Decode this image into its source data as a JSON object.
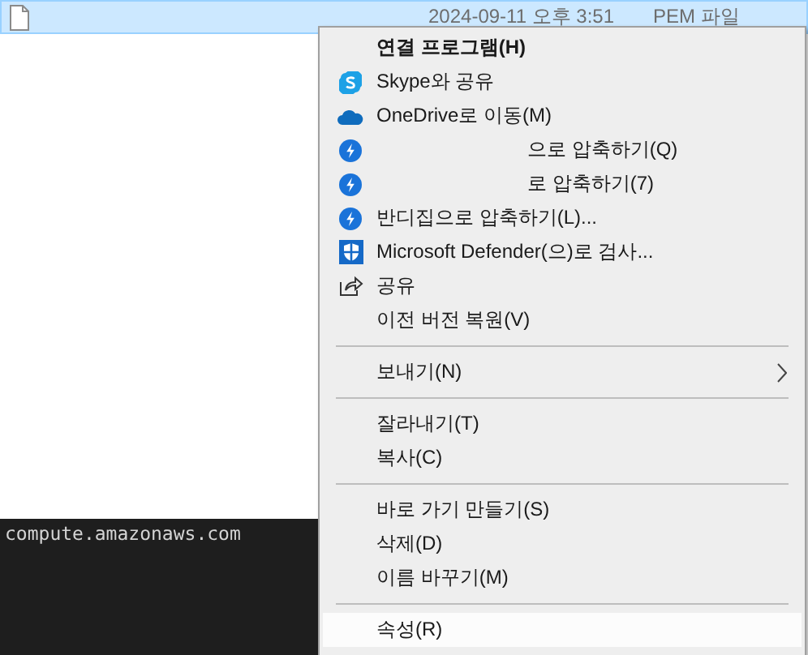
{
  "file_row": {
    "date": "2024-09-11 오후 3:51",
    "type": "PEM 파일",
    "selected": true
  },
  "terminal": {
    "line": "compute.amazonaws.com"
  },
  "context_menu": {
    "groups": [
      [
        {
          "label": "연결 프로그램(H)",
          "bold": true,
          "masked": false,
          "submenu": false,
          "highlighted": false
        },
        {
          "label": "Skype와 공유",
          "kind": "skype",
          "bold": false,
          "masked": false,
          "submenu": false,
          "highlighted": false
        },
        {
          "label": "OneDrive로 이동(M)",
          "kind": "onedrive",
          "bold": false,
          "masked": false,
          "submenu": false,
          "highlighted": false
        },
        {
          "label": "으로 압축하기(Q)",
          "kind": "bandizip",
          "bold": false,
          "masked": true,
          "submenu": false,
          "highlighted": false
        },
        {
          "label": "로 압축하기(7)",
          "kind": "bandizip",
          "bold": false,
          "masked": true,
          "submenu": false,
          "highlighted": false
        },
        {
          "label": "반디집으로 압축하기(L)...",
          "kind": "bandizip",
          "bold": false,
          "masked": false,
          "submenu": false,
          "highlighted": false
        },
        {
          "label": "Microsoft Defender(으)로 검사...",
          "kind": "defender",
          "bold": false,
          "masked": false,
          "submenu": false,
          "highlighted": false
        },
        {
          "label": "공유",
          "kind": "share",
          "bold": false,
          "masked": false,
          "submenu": false,
          "highlighted": false
        },
        {
          "label": "이전 버전 복원(V)",
          "bold": false,
          "masked": false,
          "submenu": false,
          "highlighted": false
        }
      ],
      [
        {
          "label": "보내기(N)",
          "bold": false,
          "masked": false,
          "submenu": true,
          "highlighted": false
        }
      ],
      [
        {
          "label": "잘라내기(T)",
          "bold": false,
          "masked": false,
          "submenu": false,
          "highlighted": false
        },
        {
          "label": "복사(C)",
          "bold": false,
          "masked": false,
          "submenu": false,
          "highlighted": false
        }
      ],
      [
        {
          "label": "바로 가기 만들기(S)",
          "bold": false,
          "masked": false,
          "submenu": false,
          "highlighted": false
        },
        {
          "label": "삭제(D)",
          "bold": false,
          "masked": false,
          "submenu": false,
          "highlighted": false
        },
        {
          "label": "이름 바꾸기(M)",
          "bold": false,
          "masked": false,
          "submenu": false,
          "highlighted": false
        }
      ],
      [
        {
          "label": "속성(R)",
          "bold": false,
          "masked": false,
          "submenu": false,
          "highlighted": true
        }
      ]
    ]
  }
}
